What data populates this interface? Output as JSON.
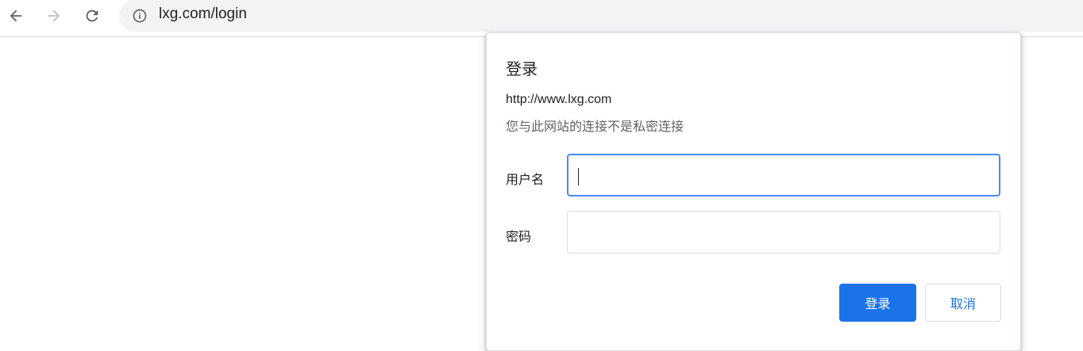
{
  "browser": {
    "url": "lxg.com/login",
    "back_icon": "arrow-left-icon",
    "forward_icon": "arrow-right-icon",
    "reload_icon": "reload-icon",
    "site_info_icon": "info-icon"
  },
  "dialog": {
    "title": "登录",
    "site_url": "http://www.lxg.com",
    "connection_note": "您与此网站的连接不是私密连接",
    "username_label": "用户名",
    "username_value": "",
    "password_label": "密码",
    "password_value": "",
    "submit_label": "登录",
    "cancel_label": "取消"
  },
  "colors": {
    "accent": "#1a73e8",
    "focus_border": "#4a8af4",
    "omnibox_bg": "#f1f3f4"
  }
}
